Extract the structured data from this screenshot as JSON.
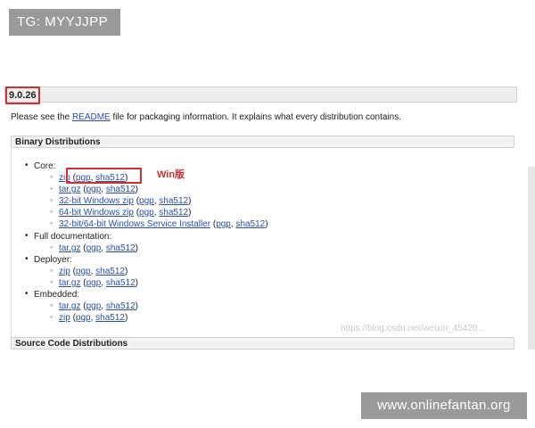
{
  "overlay": {
    "tg_label": "TG: MYYJJPP",
    "site_label": "www.onlinefantan.org",
    "watermark": "https://blog.csdn.net/weixin_45420..."
  },
  "version": "9.0.26",
  "intro": {
    "before": "Please see the ",
    "link": "README",
    "after": " file for packaging information. It explains what every distribution contains."
  },
  "sections": {
    "binary": "Binary Distributions",
    "source": "Source Code Distributions"
  },
  "annotation": {
    "label": "Win版",
    "color": "#d32f2f"
  },
  "core": {
    "label": "Core:",
    "items": [
      {
        "main": "zip",
        "pgp": "pgp",
        "sha": "sha512"
      },
      {
        "main": "tar.gz",
        "pgp": "pgp",
        "sha": "sha512"
      },
      {
        "main": "32-bit Windows zip",
        "pgp": "pgp",
        "sha": "sha512"
      },
      {
        "main": "64-bit Windows zip",
        "pgp": "pgp",
        "sha": "sha512"
      },
      {
        "main": "32-bit/64-bit Windows Service Installer",
        "pgp": "pgp",
        "sha": "sha512"
      }
    ]
  },
  "full_doc": {
    "label": "Full documentation:",
    "items": [
      {
        "main": "tar.gz",
        "pgp": "pgp",
        "sha": "sha512"
      }
    ]
  },
  "deployer": {
    "label": "Deployer:",
    "items": [
      {
        "main": "zip",
        "pgp": "pgp",
        "sha": "sha512"
      },
      {
        "main": "tar.gz",
        "pgp": "pgp",
        "sha": "sha512"
      }
    ]
  },
  "embedded": {
    "label": "Embedded:",
    "items": [
      {
        "main": "tar.gz",
        "pgp": "pgp",
        "sha": "sha512"
      },
      {
        "main": "zip",
        "pgp": "pgp",
        "sha": "sha512"
      }
    ]
  },
  "colors": {
    "link": "#2a4fb3",
    "highlight": "#d32f2f",
    "bar_bg": "#eeeeee",
    "overlay_bg": "#9a9a9a"
  }
}
